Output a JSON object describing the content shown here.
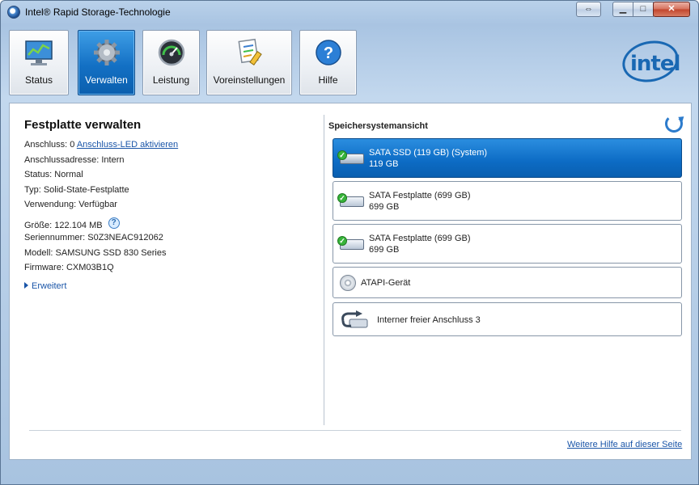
{
  "window": {
    "title": "Intel® Rapid Storage-Technologie"
  },
  "toolbar": {
    "buttons": [
      {
        "label": "Status",
        "icon": "monitor-chart-icon"
      },
      {
        "label": "Verwalten",
        "icon": "gear-icon",
        "active": true
      },
      {
        "label": "Leistung",
        "icon": "speedometer-icon"
      },
      {
        "label": "Voreinstellungen",
        "icon": "preferences-icon"
      },
      {
        "label": "Hilfe",
        "icon": "help-question-icon"
      }
    ],
    "logo": "intel"
  },
  "details": {
    "title": "Festplatte verwalten",
    "port_label": "Anschluss: 0",
    "port_led_link": "Anschluss-LED aktivieren",
    "port_address": "Anschlussadresse: Intern",
    "status": "Status: Normal",
    "type": "Typ: Solid-State-Festplatte",
    "usage": "Verwendung: Verfügbar",
    "size": "Größe: 122.104 MB",
    "serial": "Seriennummer: S0Z3NEAC912062",
    "model": "Modell: SAMSUNG SSD 830 Series",
    "firmware": "Firmware: CXM03B1Q",
    "advanced": "Erweitert"
  },
  "storage_view": {
    "title": "Speichersystemansicht",
    "devices": [
      {
        "name": "SATA SSD (119 GB) (System)",
        "size": "119 GB",
        "selected": true
      },
      {
        "name": "SATA Festplatte (699 GB)",
        "size": "699 GB"
      },
      {
        "name": "SATA Festplatte (699 GB)",
        "size": "699 GB"
      },
      {
        "name": "ATAPI-Gerät"
      },
      {
        "name": "Interner freier Anschluss 3"
      }
    ]
  },
  "footer": {
    "help_link": "Weitere Hilfe auf dieser Seite"
  },
  "colors": {
    "accent": "#0c6bc4",
    "link": "#1a55a8",
    "intel_blue": "#1968b3"
  }
}
